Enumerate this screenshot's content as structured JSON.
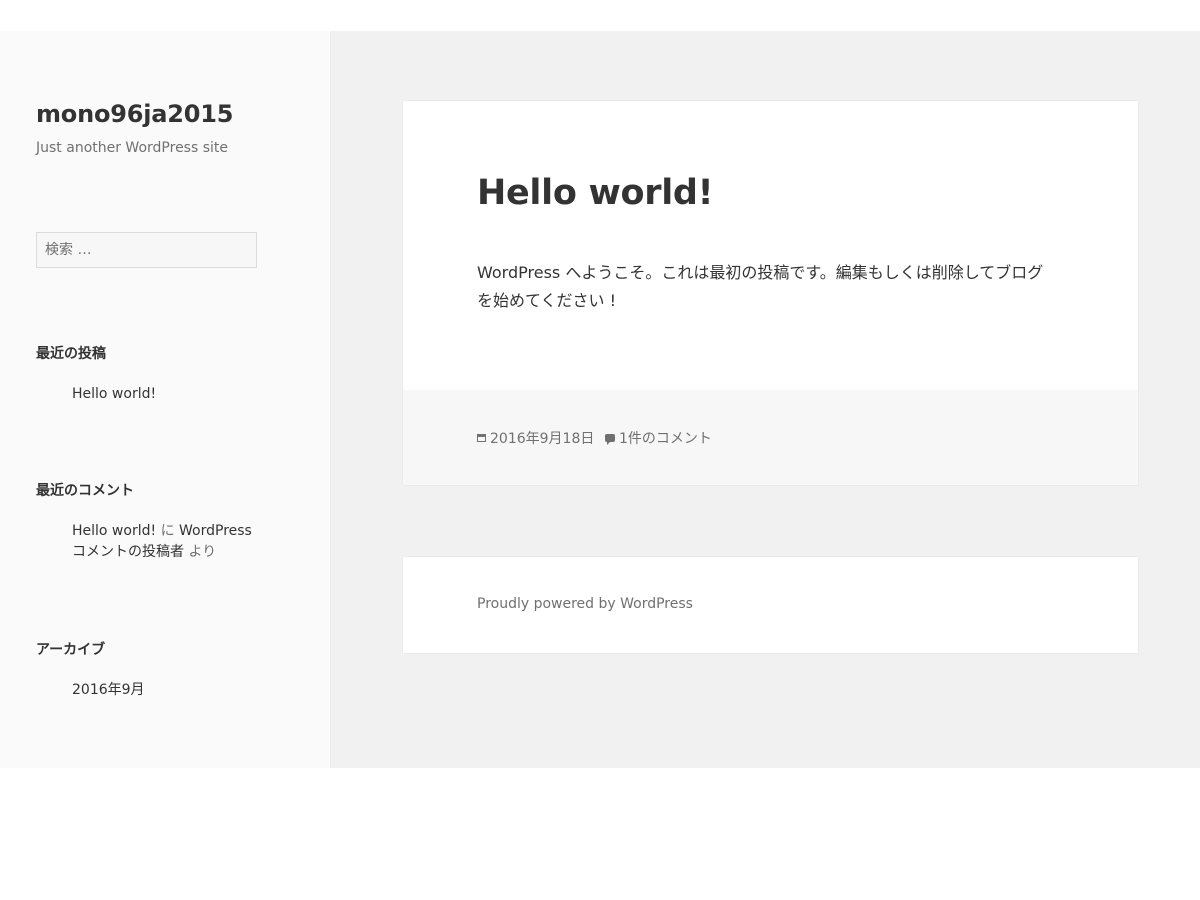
{
  "site": {
    "title": "mono96ja2015",
    "description": "Just another WordPress site"
  },
  "search": {
    "placeholder": "検索 …"
  },
  "widgets": {
    "recent_posts": {
      "title": "最近の投稿",
      "items": [
        "Hello world!"
      ]
    },
    "recent_comments": {
      "title": "最近のコメント",
      "items": [
        {
          "post": "Hello world!",
          "connector": "に",
          "author_line1": "WordPress",
          "author_line2": "コメントの投稿者",
          "suffix": "より"
        }
      ]
    },
    "archives": {
      "title": "アーカイブ",
      "items": [
        "2016年9月"
      ]
    }
  },
  "post": {
    "title": "Hello world!",
    "content": "WordPress へようこそ。これは最初の投稿です。編集もしくは削除してブログを始めてください !",
    "date": "2016年9月18日",
    "comments": "1件のコメント",
    "date_icon": "calendar-icon",
    "comments_icon": "comment-bubble-icon"
  },
  "footer": {
    "credit": "Proudly powered by WordPress"
  }
}
